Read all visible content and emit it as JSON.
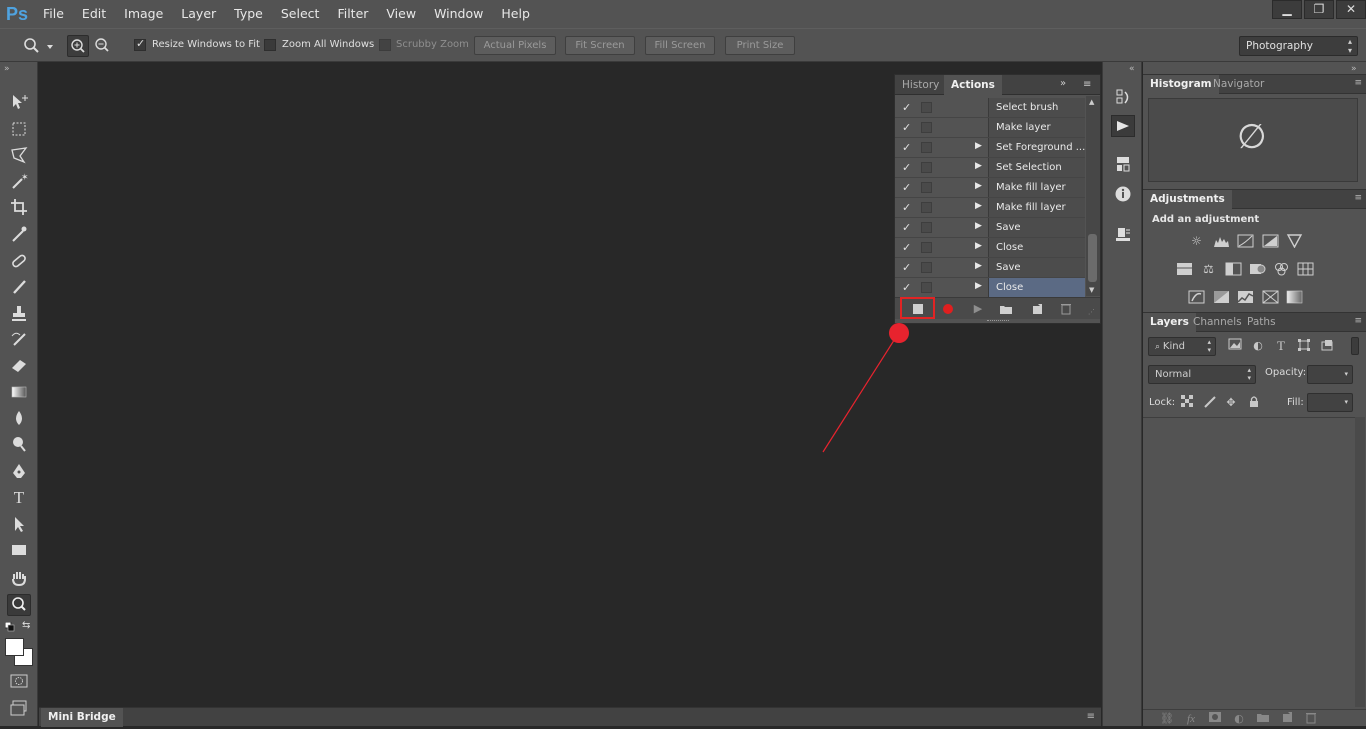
{
  "app": {
    "logo": "Ps",
    "window_controls": [
      "▁",
      "❐",
      "✕"
    ]
  },
  "menu": [
    "File",
    "Edit",
    "Image",
    "Layer",
    "Type",
    "Select",
    "Filter",
    "View",
    "Window",
    "Help"
  ],
  "options_bar": {
    "resize_windows": "Resize Windows to Fit",
    "zoom_all": "Zoom All Windows",
    "scrubby_zoom": "Scrubby Zoom",
    "actual_pixels": "Actual Pixels",
    "fit_screen": "Fit Screen",
    "fill_screen": "Fill Screen",
    "print_size": "Print Size",
    "workspace": "Photography"
  },
  "actions_panel": {
    "tabs": [
      "History",
      "Actions"
    ],
    "rows": [
      {
        "name": "Select brush",
        "has_triangle": false
      },
      {
        "name": "Make layer",
        "has_triangle": false
      },
      {
        "name": "Set Foreground ...",
        "has_triangle": true
      },
      {
        "name": "Set Selection",
        "has_triangle": true
      },
      {
        "name": "Make fill layer",
        "has_triangle": true
      },
      {
        "name": "Make fill layer",
        "has_triangle": true
      },
      {
        "name": "Save",
        "has_triangle": true
      },
      {
        "name": "Close",
        "has_triangle": true
      },
      {
        "name": "Save",
        "has_triangle": true
      },
      {
        "name": "Close",
        "has_triangle": true
      }
    ],
    "selected_index": 9,
    "check_glyph": "✓",
    "triangle_glyph": "▶"
  },
  "right_panels": {
    "histogram_tabs": [
      "Histogram",
      "Navigator"
    ],
    "histogram_symbol": "∅",
    "adjustments_tab": "Adjustments",
    "add_adjustment": "Add an adjustment",
    "layers_tabs": [
      "Layers",
      "Channels",
      "Paths"
    ],
    "kind": "Kind",
    "blend_mode": "Normal",
    "opacity_label": "Opacity:",
    "lock_label": "Lock:",
    "fill_label": "Fill:"
  },
  "mini_bridge": {
    "label": "Mini Bridge"
  },
  "colors": {
    "annotation_red": "#e8232e",
    "selected_row": "#5b6a84",
    "logo_blue": "#4fa3e0"
  }
}
